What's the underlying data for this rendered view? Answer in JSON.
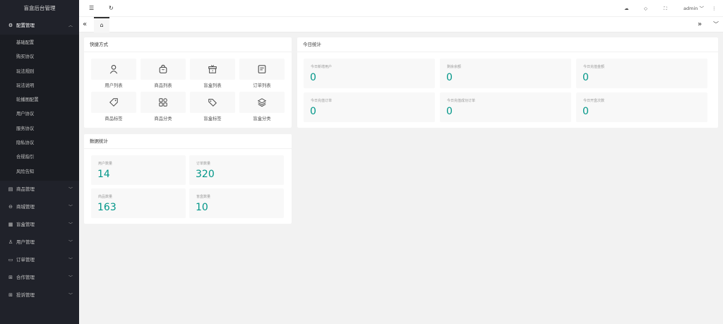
{
  "app": {
    "title": "盲盒后台管理"
  },
  "sidebar": {
    "groups": [
      {
        "label": "配置管理",
        "icon": "gear-icon",
        "open": true,
        "items": [
          "基础配置",
          "购买协议",
          "玩法规则",
          "玩法说明",
          "轮播图配置",
          "用户协议",
          "服务协议",
          "隐私协议",
          "合规指引",
          "风险告知"
        ]
      },
      {
        "label": "商品管理",
        "icon": "goods-icon"
      },
      {
        "label": "商城管理",
        "icon": "bag-icon"
      },
      {
        "label": "盲盒管理",
        "icon": "gift-icon"
      },
      {
        "label": "用户管理",
        "icon": "user-icon"
      },
      {
        "label": "订单管理",
        "icon": "order-icon"
      },
      {
        "label": "合作管理",
        "icon": "cooperation-icon"
      },
      {
        "label": "投诉管理",
        "icon": "complaint-icon"
      }
    ]
  },
  "header": {
    "user": "admin"
  },
  "quick": {
    "title": "快捷方式",
    "items": [
      {
        "label": "用户列表",
        "icon": "user-icon"
      },
      {
        "label": "商品列表",
        "icon": "bag-icon"
      },
      {
        "label": "盲盒列表",
        "icon": "giftbox-icon"
      },
      {
        "label": "订单列表",
        "icon": "order-icon"
      },
      {
        "label": "商品标签",
        "icon": "tag-icon"
      },
      {
        "label": "商品分类",
        "icon": "grid-icon"
      },
      {
        "label": "盲盒标签",
        "icon": "tag-icon"
      },
      {
        "label": "盲盒分类",
        "icon": "layers-icon"
      }
    ]
  },
  "data_stats": {
    "title": "数据统计",
    "items": [
      {
        "label": "用户数量",
        "value": "14"
      },
      {
        "label": "订单数量",
        "value": "320"
      },
      {
        "label": "商品数量",
        "value": "163"
      },
      {
        "label": "盲盒数量",
        "value": "10"
      }
    ]
  },
  "today_stats": {
    "title": "今日统计",
    "items": [
      {
        "label": "今日新增用户",
        "value": "0"
      },
      {
        "label": "剩余余额",
        "value": "0"
      },
      {
        "label": "今日充值金额",
        "value": "0"
      },
      {
        "label": "今日充值订单",
        "value": "0"
      },
      {
        "label": "今日充值成功订单",
        "value": "0"
      },
      {
        "label": "今日开盒次数",
        "value": "0"
      }
    ]
  },
  "colors": {
    "sidebar_bg": "#20222a",
    "accent": "#009688",
    "page_bg": "#f2f2f2"
  }
}
